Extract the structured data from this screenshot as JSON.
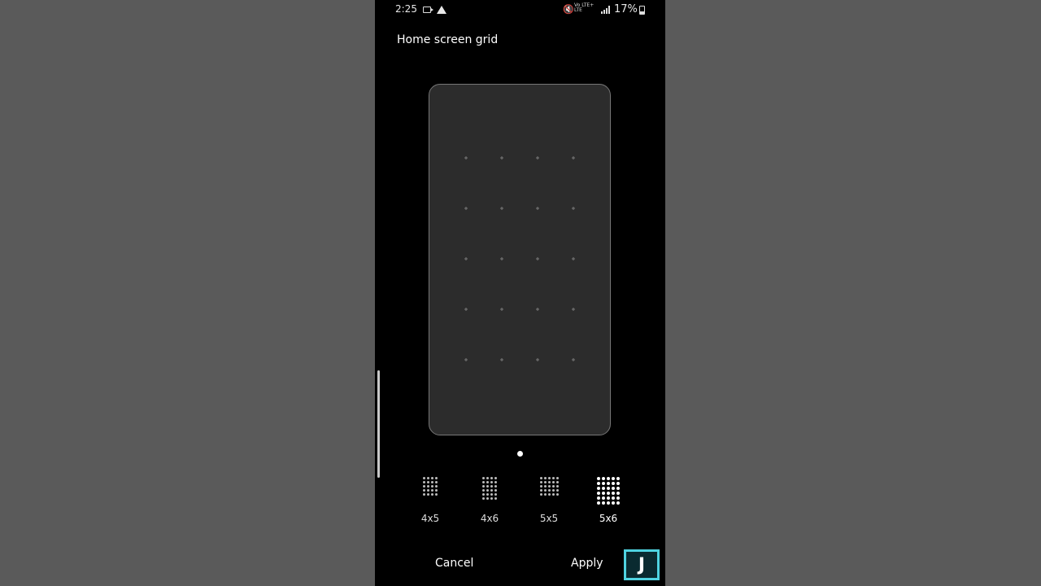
{
  "status_bar": {
    "time": "2:25",
    "network_labels": [
      "Vo",
      "LTE+",
      "LTE"
    ],
    "battery": "17%"
  },
  "title": "Home screen grid",
  "preview": {
    "columns": 4,
    "rows": 5,
    "dot_color": "#7a7a7a"
  },
  "grid_options": [
    {
      "label": "4x5",
      "cols": 4,
      "rows": 5,
      "selected": false
    },
    {
      "label": "4x6",
      "cols": 4,
      "rows": 6,
      "selected": false
    },
    {
      "label": "5x5",
      "cols": 5,
      "rows": 5,
      "selected": false
    },
    {
      "label": "5x6",
      "cols": 5,
      "rows": 6,
      "selected": true
    }
  ],
  "buttons": {
    "cancel": "Cancel",
    "apply": "Apply"
  },
  "watermark": {
    "letter": "J",
    "color": "#4fd2e0"
  },
  "colors": {
    "background": "#5a5a5a",
    "phone_bg": "#000000",
    "preview_bg": "#2c2c2c"
  }
}
